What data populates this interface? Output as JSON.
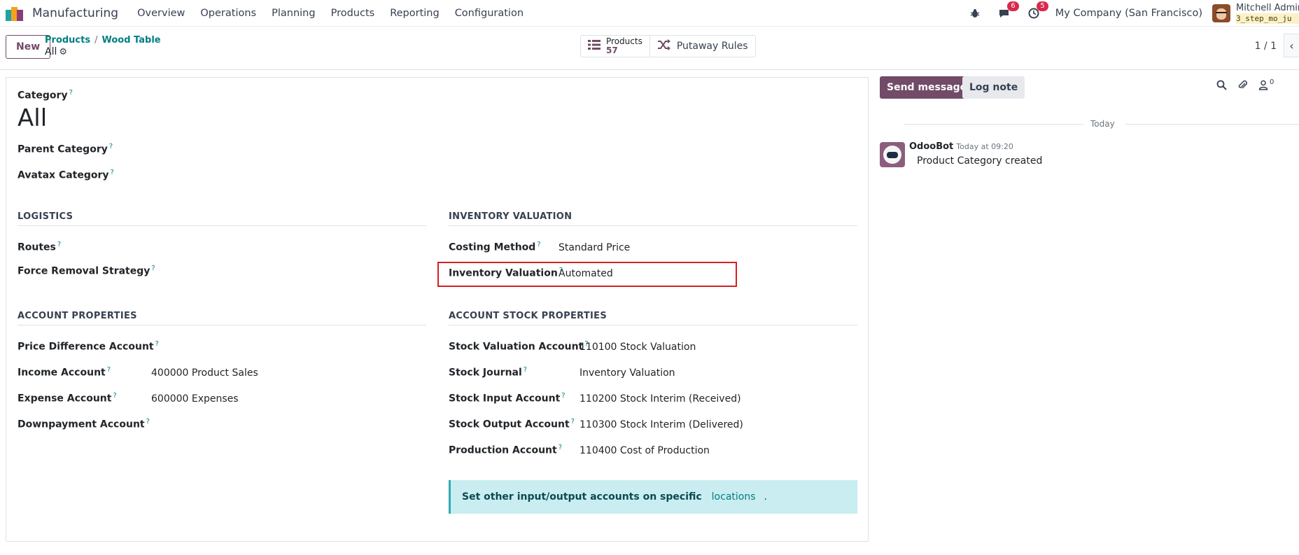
{
  "navbar": {
    "app_name": "Manufacturing",
    "menu": [
      "Overview",
      "Operations",
      "Planning",
      "Products",
      "Reporting",
      "Configuration"
    ],
    "messages_badge": "6",
    "activities_badge": "5",
    "company": "My Company (San Francisco)",
    "user_name": "Mitchell Admin",
    "user_db": "3_step_mo_ju"
  },
  "control": {
    "new_label": "New",
    "breadcrumb": [
      "Products",
      "Wood Table"
    ],
    "breadcrumb_sep": "/",
    "current": "All",
    "smart_products_label": "Products",
    "smart_products_count": "57",
    "smart_putaway_label": "Putaway Rules",
    "pager": "1 / 1"
  },
  "form": {
    "category_label": "Category",
    "category_value": "All",
    "parent_category_label": "Parent Category",
    "avatax_category_label": "Avatax Category",
    "help_mark": "?",
    "logistics": {
      "title": "LOGISTICS",
      "routes_label": "Routes",
      "force_removal_label": "Force Removal Strategy"
    },
    "inventory_valuation": {
      "title": "INVENTORY VALUATION",
      "costing_method_label": "Costing Method",
      "costing_method_value": "Standard Price",
      "valuation_label": "Inventory Valuation",
      "valuation_value": "Automated"
    },
    "account_properties": {
      "title": "ACCOUNT PROPERTIES",
      "price_diff_label": "Price Difference Account",
      "income_label": "Income Account",
      "income_value": "400000 Product Sales",
      "expense_label": "Expense Account",
      "expense_value": "600000 Expenses",
      "downpayment_label": "Downpayment Account"
    },
    "stock_properties": {
      "title": "ACCOUNT STOCK PROPERTIES",
      "valuation_account_label": "Stock Valuation Account",
      "valuation_account_value": "110100 Stock Valuation",
      "journal_label": "Stock Journal",
      "journal_value": "Inventory Valuation",
      "input_label": "Stock Input Account",
      "input_value": "110200 Stock Interim (Received)",
      "output_label": "Stock Output Account",
      "output_value": "110300 Stock Interim (Delivered)",
      "production_label": "Production Account",
      "production_value": "110400 Cost of Production"
    },
    "alert": {
      "text": "Set other input/output accounts on specific",
      "link": "locations",
      "end": "."
    }
  },
  "chatter": {
    "send_label": "Send message",
    "log_label": "Log note",
    "followers_count": "0",
    "today": "Today",
    "author": "OdooBot",
    "time": "Today at 09:20",
    "message": "Product Category created"
  },
  "colors": {
    "brand": "#714b67",
    "link": "#017e84",
    "highlight_border": "#d62020",
    "alert_bg": "#c9edf0"
  }
}
